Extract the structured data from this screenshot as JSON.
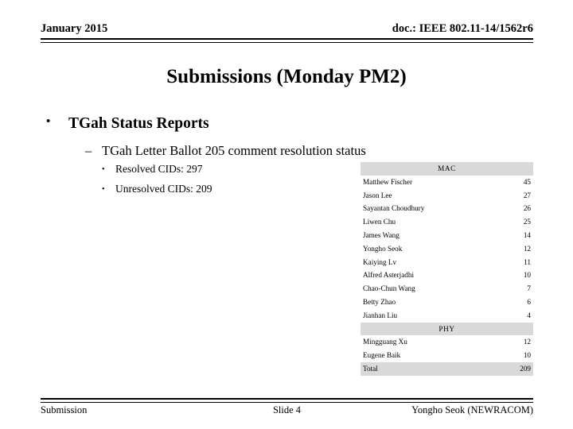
{
  "header": {
    "date": "January 2015",
    "doc": "doc.: IEEE 802.11-14/1562r6"
  },
  "title": "Submissions (Monday PM2)",
  "bullets": {
    "level1": {
      "marker": "•",
      "text": "TGah Status Reports"
    },
    "level2": {
      "marker": "–",
      "text": "TGah Letter Ballot 205 comment resolution status"
    },
    "level3": [
      {
        "marker": "•",
        "text": "Resolved CIDs: 297"
      },
      {
        "marker": "•",
        "text": "Unresolved CIDs: 209"
      }
    ]
  },
  "table": {
    "sections": [
      {
        "label": "MAC",
        "rows": [
          {
            "name": "Matthew Fischer",
            "value": "45"
          },
          {
            "name": "Jason Lee",
            "value": "27"
          },
          {
            "name": "Sayantan Choudhury",
            "value": "26"
          },
          {
            "name": "Liwen Chu",
            "value": "25"
          },
          {
            "name": "James Wang",
            "value": "14"
          },
          {
            "name": "Yongho Seok",
            "value": "12"
          },
          {
            "name": "Kaiying Lv",
            "value": "11"
          },
          {
            "name": "Alfred Asterjadhi",
            "value": "10"
          },
          {
            "name": "Chao-Chun Wang",
            "value": "7"
          },
          {
            "name": "Betty Zhao",
            "value": "6"
          },
          {
            "name": "Jianhan Liu",
            "value": "4"
          }
        ]
      },
      {
        "label": "PHY",
        "rows": [
          {
            "name": "Mingguang Xu",
            "value": "12"
          },
          {
            "name": "Eugene Baik",
            "value": "10"
          }
        ]
      }
    ],
    "total": {
      "name": "Total",
      "value": "209"
    },
    "shade_color": "#d9d9d9"
  },
  "footer": {
    "left": "Submission",
    "center": "Slide 4",
    "right": "Yongho Seok (NEWRACOM)"
  }
}
